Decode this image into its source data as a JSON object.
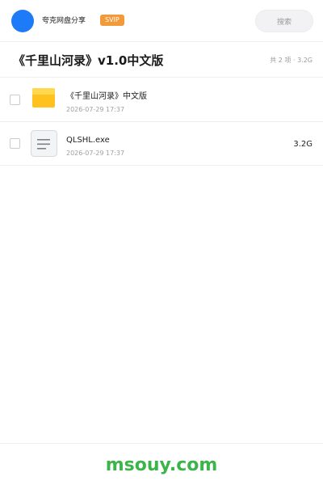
{
  "header": {
    "user_name": "夸克网盘分享",
    "badge": "SVIP",
    "search_placeholder": "搜索"
  },
  "share": {
    "title": "《千里山河录》v1.0中文版",
    "meta": "共 2 项 · 3.2G"
  },
  "files": [
    {
      "name": "《千里山河录》中文版",
      "date": "2026-07-29 17:37",
      "size": "",
      "icon": "folder-icon"
    },
    {
      "name": "QLSHL.exe",
      "date": "2026-07-29 17:37",
      "size": "3.2G",
      "icon": "document-icon"
    }
  ],
  "footer": {
    "watermark": "msouy.com"
  },
  "colors": {
    "avatar": "#1d7bf7",
    "badge": "#f29a3a",
    "folder": "#ffc11e",
    "watermark": "#3bb54a"
  }
}
